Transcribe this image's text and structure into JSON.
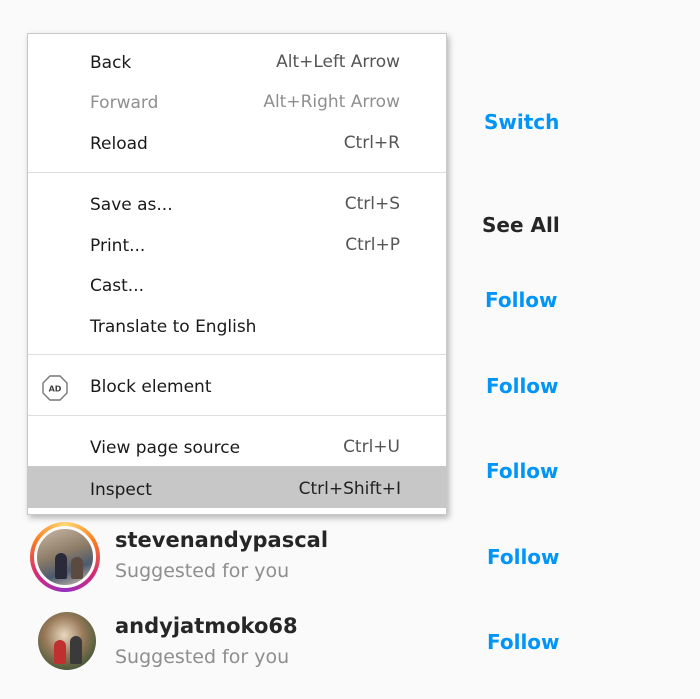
{
  "context_menu": {
    "items": [
      {
        "label": "Back",
        "shortcut": "Alt+Left Arrow"
      },
      {
        "label": "Forward",
        "shortcut": "Alt+Right Arrow",
        "disabled": true
      },
      {
        "label": "Reload",
        "shortcut": "Ctrl+R"
      },
      {
        "label": "Save as...",
        "shortcut": "Ctrl+S"
      },
      {
        "label": "Print...",
        "shortcut": "Ctrl+P"
      },
      {
        "label": "Cast...",
        "shortcut": ""
      },
      {
        "label": "Translate to English",
        "shortcut": ""
      },
      {
        "label": "Block element",
        "shortcut": "",
        "icon": "adblock-icon",
        "icon_text": "AD"
      },
      {
        "label": "View page source",
        "shortcut": "Ctrl+U"
      },
      {
        "label": "Inspect",
        "shortcut": "Ctrl+Shift+I",
        "highlighted": true
      }
    ]
  },
  "page": {
    "switch_label": "Switch",
    "see_all_label": "See All",
    "follow_label": "Follow",
    "suggestions": [
      {
        "username": "stevenandypascal",
        "subtitle": "Suggested for you",
        "has_story_ring": true
      },
      {
        "username": "andyjatmoko68",
        "subtitle": "Suggested for you",
        "has_story_ring": false
      }
    ]
  },
  "colors": {
    "accent": "#0095f6",
    "text_primary": "#262626",
    "text_secondary": "#8e8e8e",
    "menu_highlight": "#c7c7c7"
  }
}
